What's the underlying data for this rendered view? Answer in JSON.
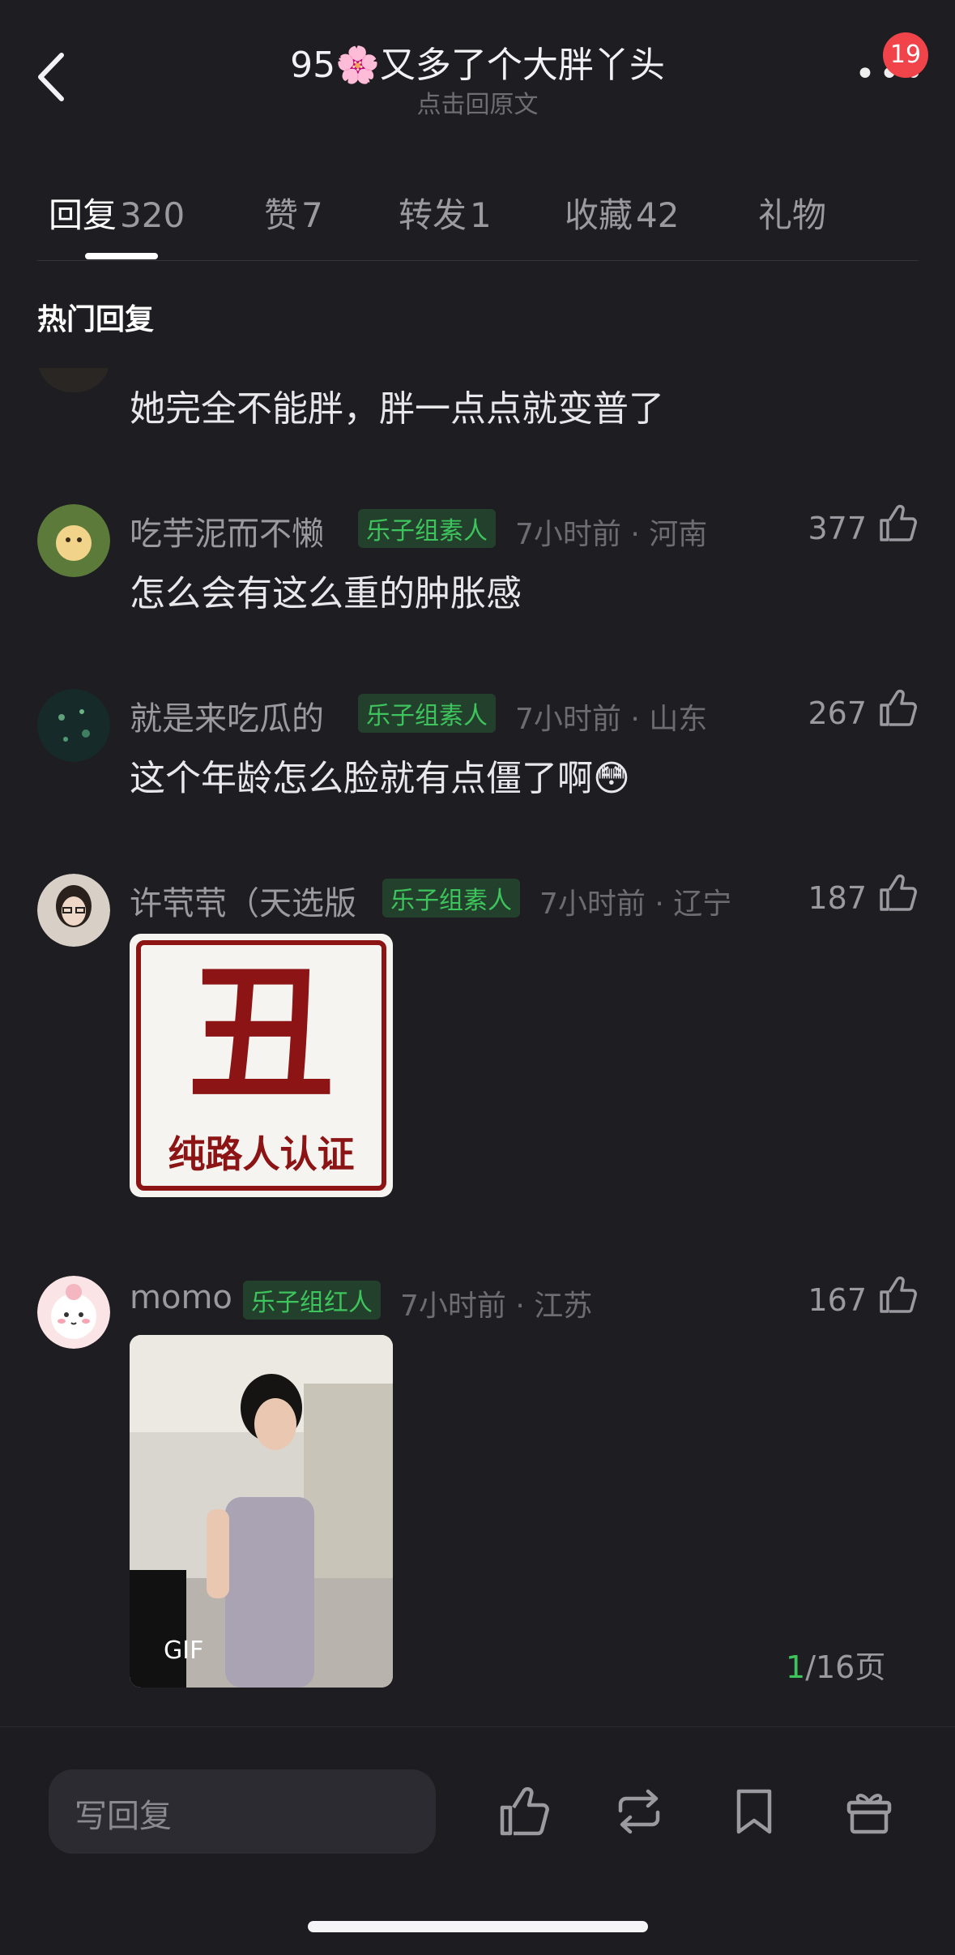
{
  "header": {
    "title": "95🌸又多了个大胖丫头",
    "subtitle": "点击回原文",
    "more_icon": "more-dots-icon",
    "notification_badge": "19"
  },
  "tabs": [
    {
      "name": "回复",
      "count": "320"
    },
    {
      "name": "赞",
      "count": "7"
    },
    {
      "name": "转发",
      "count": "1"
    },
    {
      "name": "收藏",
      "count": "42"
    },
    {
      "name": "礼物",
      "count": ""
    }
  ],
  "section_title": "热门回复",
  "comments": [
    {
      "text": "她完全不能胖，胖一点点就变普了"
    },
    {
      "username": "吃芋泥而不懒",
      "tag": "乐子组素人",
      "meta": "7小时前 · 河南",
      "likes": "377",
      "text": "怎么会有这么重的肿胀感"
    },
    {
      "username": "就是来吃瓜的",
      "tag": "乐子组素人",
      "meta": "7小时前 · 山东",
      "likes": "267",
      "text": "这个年龄怎么脸就有点僵了啊😳"
    },
    {
      "username": "许茕茕（天选版",
      "tag": "乐子组素人",
      "meta": "7小时前 · 辽宁",
      "likes": "187",
      "stamp_big": "丑",
      "stamp_small": "纯路人认证"
    },
    {
      "username": "momo",
      "tag": "乐子组红人",
      "meta": "7小时前 · 江苏",
      "likes": "167",
      "gif_label": "GIF"
    }
  ],
  "pager": {
    "current": "1",
    "total": "/16页"
  },
  "bottom_bar": {
    "reply_placeholder": "写回复",
    "icons": [
      "thumb-up-icon",
      "repost-icon",
      "bookmark-icon",
      "gift-icon"
    ]
  },
  "colors": {
    "background": "#1d1d22",
    "accent_green": "#3ec45c",
    "badge_red": "#f0444a"
  }
}
